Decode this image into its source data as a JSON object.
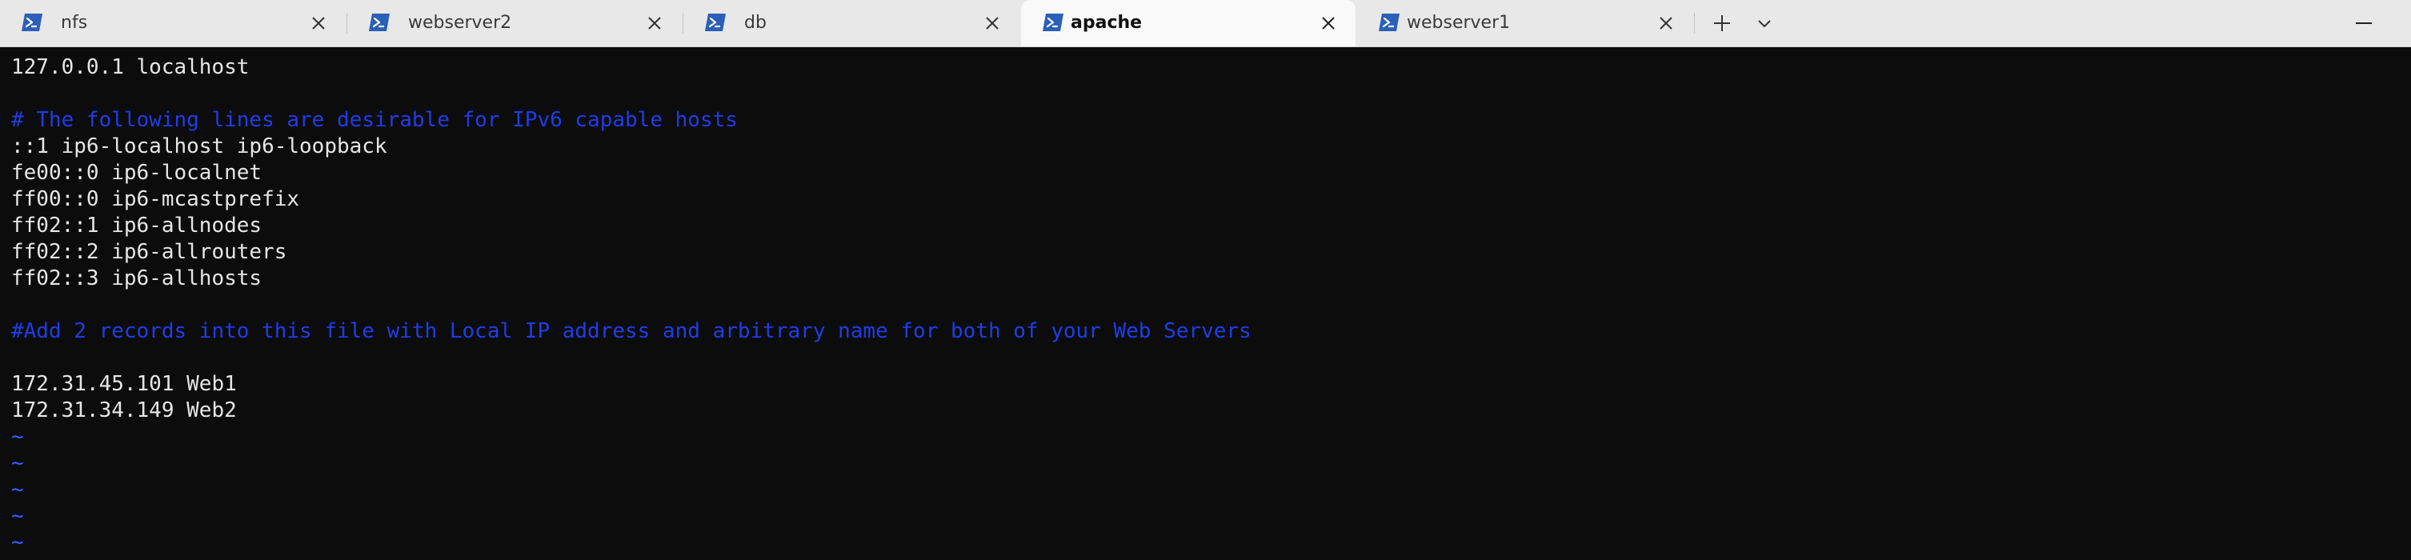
{
  "tabs": [
    {
      "label": "nfs",
      "active": false
    },
    {
      "label": "webserver2",
      "active": false
    },
    {
      "label": "db",
      "active": false
    },
    {
      "label": "apache",
      "active": true
    },
    {
      "label": "webserver1",
      "active": false
    }
  ],
  "tab_icon": "powershell-icon",
  "toolbar": {
    "new_tab_icon": "plus-icon",
    "dropdown_icon": "chevron-down-icon",
    "minimize_icon": "minimize-icon"
  },
  "terminal": {
    "lines": [
      {
        "text": "127.0.0.1 localhost",
        "kind": "text"
      },
      {
        "text": "",
        "kind": "text"
      },
      {
        "text": "# The following lines are desirable for IPv6 capable hosts",
        "kind": "comment"
      },
      {
        "text": "::1 ip6-localhost ip6-loopback",
        "kind": "text"
      },
      {
        "text": "fe00::0 ip6-localnet",
        "kind": "text"
      },
      {
        "text": "ff00::0 ip6-mcastprefix",
        "kind": "text"
      },
      {
        "text": "ff02::1 ip6-allnodes",
        "kind": "text"
      },
      {
        "text": "ff02::2 ip6-allrouters",
        "kind": "text"
      },
      {
        "text": "ff02::3 ip6-allhosts",
        "kind": "text"
      },
      {
        "text": "",
        "kind": "text"
      },
      {
        "text": "#Add 2 records into this file with Local IP address and arbitrary name for both of your Web Servers",
        "kind": "comment"
      },
      {
        "text": "",
        "kind": "text"
      },
      {
        "text": "172.31.45.101 Web1",
        "kind": "text"
      },
      {
        "text": "172.31.34.149 Web2",
        "kind": "text"
      },
      {
        "text": "~",
        "kind": "tilde"
      },
      {
        "text": "~",
        "kind": "tilde"
      },
      {
        "text": "~",
        "kind": "tilde"
      },
      {
        "text": "~",
        "kind": "tilde"
      },
      {
        "text": "~",
        "kind": "tilde"
      }
    ]
  },
  "colors": {
    "terminal_bg": "#0c0c0c",
    "text": "#e6e6e6",
    "comment": "#1e3de8",
    "tilde": "#3c5cff",
    "tab_icon": "#2b5fb8"
  }
}
